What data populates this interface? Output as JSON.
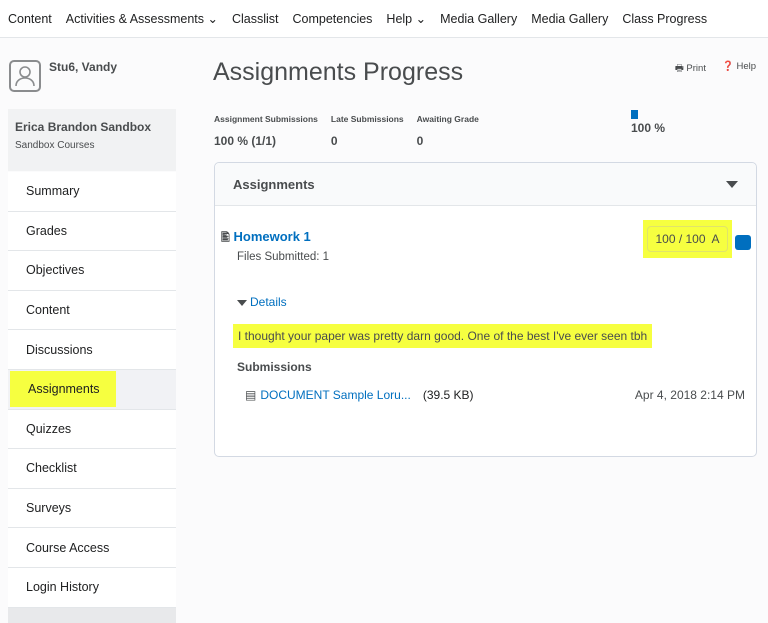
{
  "nav": {
    "items": [
      "Content",
      "Activities & Assessments ⌄",
      "Classlist",
      "Competencies",
      "Help ⌄",
      "Media Gallery",
      "Media Gallery",
      "Class Progress"
    ]
  },
  "user": {
    "name": "Stu6, Vandy"
  },
  "course": {
    "title": "Erica Brandon Sandbox",
    "subtitle": "Sandbox Courses"
  },
  "sidebar": {
    "items": [
      {
        "label": "Summary"
      },
      {
        "label": "Grades"
      },
      {
        "label": "Objectives"
      },
      {
        "label": "Content"
      },
      {
        "label": "Discussions"
      },
      {
        "label": "Assignments",
        "active": true
      },
      {
        "label": "Quizzes"
      },
      {
        "label": "Checklist"
      },
      {
        "label": "Surveys"
      },
      {
        "label": "Course Access"
      },
      {
        "label": "Login History"
      }
    ]
  },
  "page": {
    "title": "Assignments Progress",
    "print": "Print",
    "help": "Help"
  },
  "stats": [
    {
      "label": "Assignment Submissions",
      "value": "100 % (1/1)"
    },
    {
      "label": "Late Submissions",
      "value": "0"
    },
    {
      "label": "Awaiting Grade",
      "value": "0"
    }
  ],
  "progress": {
    "value_percent": 100,
    "label": "100 %",
    "color": "#006fbf"
  },
  "panel": {
    "title": "Assignments",
    "assignment": {
      "name": "Homework 1",
      "files": "Files Submitted: 1",
      "grade": "100 / 100  A",
      "details": "Details",
      "feedback": "I thought your paper was pretty darn good. One of the best I've ever seen tbh",
      "submissions_label": "Submissions",
      "submission": {
        "name": "DOCUMENT Sample Loru...",
        "size": "(39.5 KB)",
        "date": "Apr 4, 2018 2:14 PM"
      }
    }
  },
  "colors": {
    "highlight": "#f6ff40",
    "link": "#006fbf"
  }
}
